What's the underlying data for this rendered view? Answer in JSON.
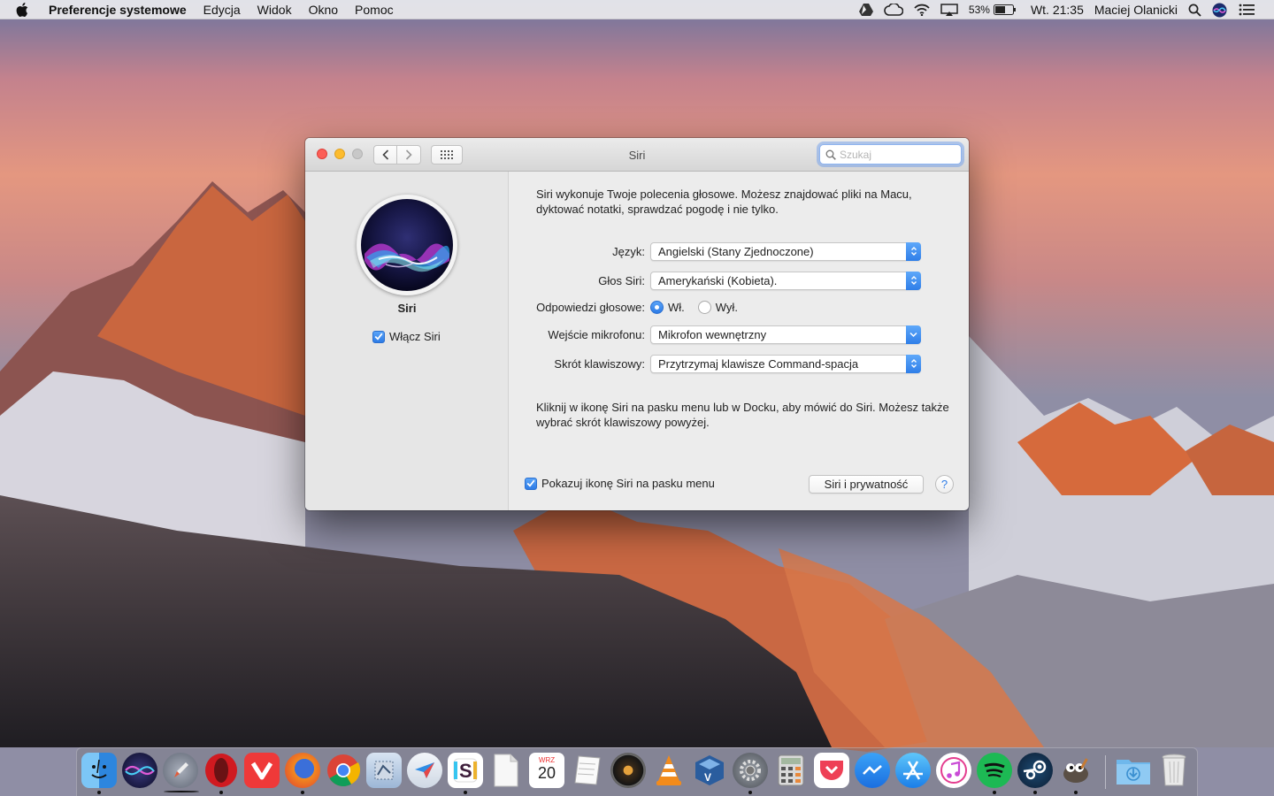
{
  "menubar": {
    "app_name": "Preferencje systemowe",
    "menus": [
      "Edycja",
      "Widok",
      "Okno",
      "Pomoc"
    ],
    "battery_percent": "53%",
    "clock": "Wt. 21:35",
    "user": "Maciej Olanicki"
  },
  "window": {
    "title": "Siri",
    "search_placeholder": "Szukaj"
  },
  "left_pane": {
    "title": "Siri",
    "enable_label": "Włącz Siri",
    "enable_checked": true
  },
  "right_pane": {
    "intro": "Siri wykonuje Twoje polecenia głosowe. Możesz znajdować pliki na Macu, dyktować notatki, sprawdzać pogodę i nie tylko.",
    "language_label": "Język:",
    "language_value": "Angielski (Stany Zjednoczone)",
    "voice_label": "Głos Siri:",
    "voice_value": "Amerykański (Kobieta).",
    "feedback_label": "Odpowiedzi głosowe:",
    "feedback_on": "Wł.",
    "feedback_off": "Wył.",
    "feedback_selected": "Wł.",
    "mic_label": "Wejście mikrofonu:",
    "mic_value": "Mikrofon wewnętrzny",
    "shortcut_label": "Skrót klawiszowy:",
    "shortcut_value": "Przytrzymaj klawisze Command-spacja",
    "hint": "Kliknij w ikonę Siri na pasku menu lub w Docku, aby mówić do Siri. Możesz także wybrać skrót klawiszowy powyżej.",
    "show_menu_icon_label": "Pokazuj ikonę Siri na pasku menu",
    "show_menu_icon_checked": true,
    "privacy_button": "Siri i prywatność",
    "help_button": "?"
  },
  "dock": {
    "calendar_month": "WRZ",
    "calendar_day": "20",
    "apps": [
      "finder",
      "siri",
      "launchpad",
      "opera",
      "vivaldi",
      "firefox",
      "chrome",
      "mail-app",
      "airmail",
      "slack",
      "blank-doc",
      "calendar",
      "notes",
      "speaker",
      "vlc",
      "virtualbox",
      "system-preferences",
      "calculator",
      "pocket",
      "messenger",
      "app-store",
      "itunes",
      "spotify",
      "steam",
      "gimp",
      "downloads-folder",
      "trash"
    ]
  },
  "colors": {
    "accent": "#2d7be6",
    "window_bg": "#ececec"
  }
}
